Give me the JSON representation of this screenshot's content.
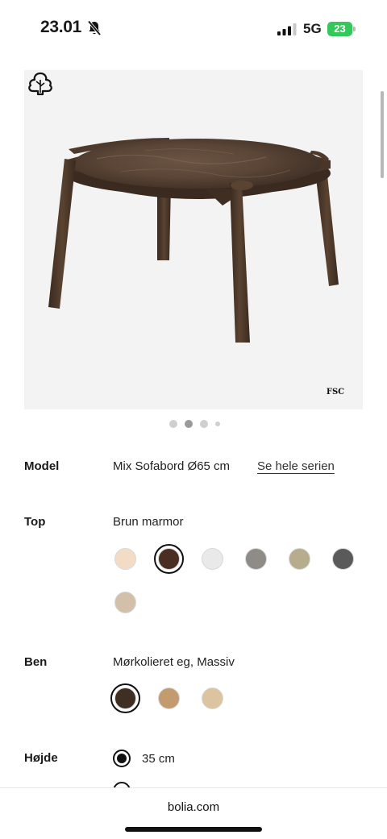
{
  "status_bar": {
    "time": "23.01",
    "network": "5G",
    "battery": "23"
  },
  "product": {
    "image_alt": "Mix Sofabord",
    "certification_label": "FSC",
    "gallery_dot_count": 4,
    "gallery_active_index": 1
  },
  "specs": {
    "model": {
      "label": "Model",
      "value": "Mix Sofabord Ø65 cm",
      "link": "Se hele serien"
    },
    "top": {
      "label": "Top",
      "value": "Brun marmor",
      "swatches": [
        {
          "name": "swatch-light-beige",
          "color": "#f2dcc6",
          "selected": false
        },
        {
          "name": "swatch-brown-marble",
          "color": "#4a2e22",
          "selected": true
        },
        {
          "name": "swatch-white",
          "color": "#e9e9e9",
          "selected": false
        },
        {
          "name": "swatch-grey-stone",
          "color": "#8f8c87",
          "selected": false
        },
        {
          "name": "swatch-olive-beige",
          "color": "#b7ad8c",
          "selected": false
        },
        {
          "name": "swatch-dark-grey",
          "color": "#5a5a5a",
          "selected": false
        },
        {
          "name": "swatch-sand-marble",
          "color": "#d2c0aa",
          "selected": false
        }
      ]
    },
    "legs": {
      "label": "Ben",
      "value": "Mørkolieret eg, Massiv",
      "swatches": [
        {
          "name": "swatch-dark-oiled-oak",
          "color": "#3f2f23",
          "selected": true
        },
        {
          "name": "swatch-oiled-oak",
          "color": "#c49a6f",
          "selected": false
        },
        {
          "name": "swatch-light-oak",
          "color": "#dcc4a0",
          "selected": false
        }
      ]
    },
    "height": {
      "label": "Højde",
      "options": [
        {
          "label": "35 cm",
          "checked": true
        }
      ]
    }
  },
  "browser": {
    "url": "bolia.com"
  }
}
